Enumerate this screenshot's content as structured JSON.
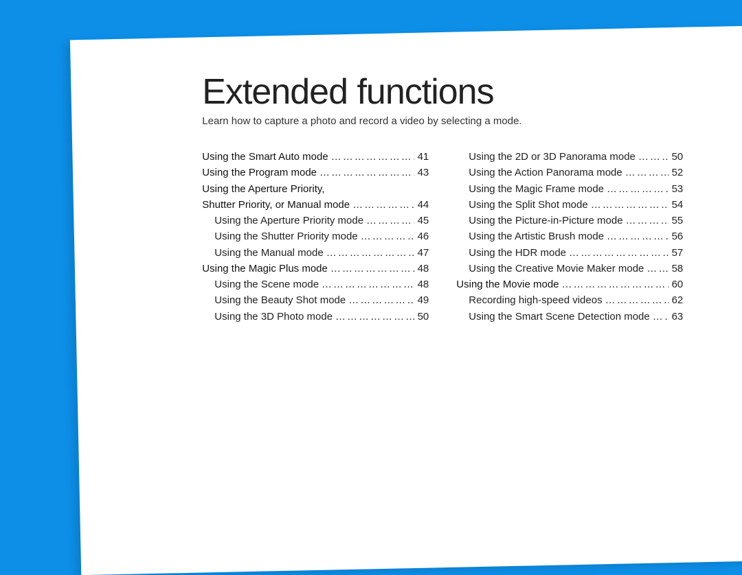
{
  "title": "Extended functions",
  "subtitle": "Learn how to capture a photo and record a video by selecting a mode.",
  "left_column": [
    {
      "label": "Using the Smart Auto mode",
      "page": "41",
      "section": true
    },
    {
      "label": "Using the Program mode",
      "page": "43",
      "section": true
    },
    {
      "label": "Using the Aperture Priority,",
      "section": true,
      "nopage": true
    },
    {
      "label": "Shutter Priority, or Manual mode",
      "page": "44",
      "section": true
    },
    {
      "label": "Using the Aperture Priority mode",
      "page": "45",
      "sub": true
    },
    {
      "label": "Using the Shutter Priority mode",
      "page": "46",
      "sub": true
    },
    {
      "label": "Using the Manual mode",
      "page": "47",
      "sub": true
    },
    {
      "label": "Using the Magic Plus mode",
      "page": "48",
      "section": true
    },
    {
      "label": "Using the Scene mode",
      "page": "48",
      "sub": true
    },
    {
      "label": "Using the Beauty Shot mode",
      "page": "49",
      "sub": true
    },
    {
      "label": "Using the 3D Photo mode",
      "page": "50",
      "sub": true
    }
  ],
  "right_column": [
    {
      "label": "Using the 2D or 3D Panorama mode",
      "page": "50",
      "sub": true
    },
    {
      "label": "Using the Action Panorama mode",
      "page": "52",
      "sub": true
    },
    {
      "label": "Using the Magic Frame mode",
      "page": "53",
      "sub": true
    },
    {
      "label": "Using the Split Shot mode",
      "page": "54",
      "sub": true
    },
    {
      "label": "Using the Picture-in-Picture mode",
      "page": "55",
      "sub": true
    },
    {
      "label": "Using the Artistic Brush mode",
      "page": "56",
      "sub": true
    },
    {
      "label": "Using the HDR mode",
      "page": "57",
      "sub": true
    },
    {
      "label": "Using the Creative Movie Maker mode",
      "page": "58",
      "sub": true
    },
    {
      "label": "Using the Movie mode",
      "page": "60",
      "section": true
    },
    {
      "label": "Recording high-speed videos",
      "page": "62",
      "sub": true
    },
    {
      "label": "Using the Smart Scene Detection mode",
      "page": "63",
      "sub": true
    }
  ]
}
